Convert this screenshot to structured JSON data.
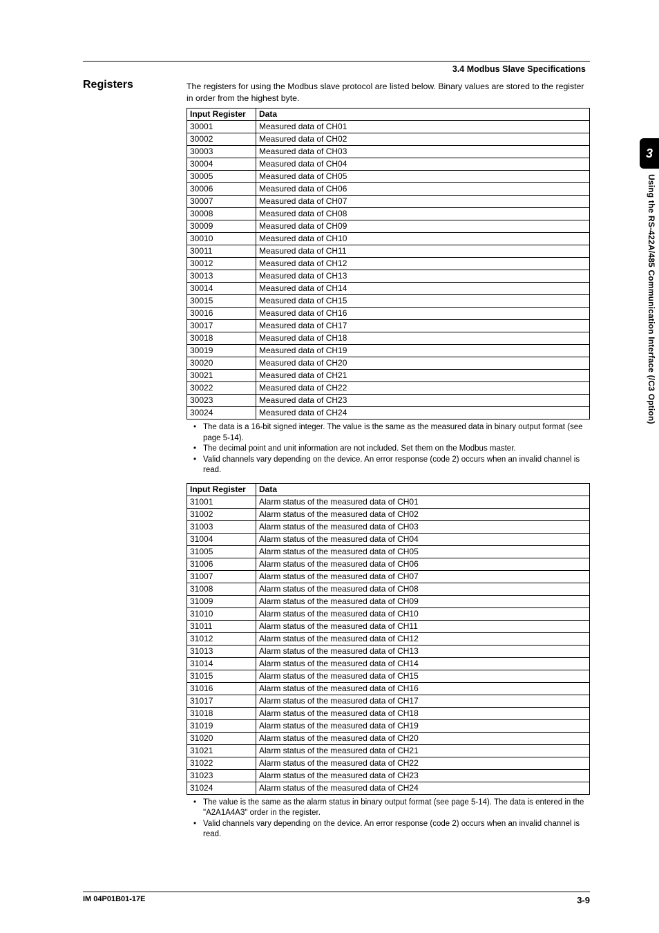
{
  "header": {
    "section_number_title": "3.4  Modbus Slave Specifications"
  },
  "heading": "Registers",
  "intro": "The registers for using the Modbus slave protocol are listed below. Binary values are stored to the register in order from the highest byte.",
  "table1": {
    "cols": [
      "Input Register",
      "Data"
    ],
    "rows": [
      [
        "30001",
        "Measured data of CH01"
      ],
      [
        "30002",
        "Measured data of CH02"
      ],
      [
        "30003",
        "Measured data of CH03"
      ],
      [
        "30004",
        "Measured data of CH04"
      ],
      [
        "30005",
        "Measured data of CH05"
      ],
      [
        "30006",
        "Measured data of CH06"
      ],
      [
        "30007",
        "Measured data of CH07"
      ],
      [
        "30008",
        "Measured data of CH08"
      ],
      [
        "30009",
        "Measured data of CH09"
      ],
      [
        "30010",
        "Measured data of CH10"
      ],
      [
        "30011",
        "Measured data of CH11"
      ],
      [
        "30012",
        "Measured data of CH12"
      ],
      [
        "30013",
        "Measured data of CH13"
      ],
      [
        "30014",
        "Measured data of CH14"
      ],
      [
        "30015",
        "Measured data of CH15"
      ],
      [
        "30016",
        "Measured data of CH16"
      ],
      [
        "30017",
        "Measured data of CH17"
      ],
      [
        "30018",
        "Measured data of CH18"
      ],
      [
        "30019",
        "Measured data of CH19"
      ],
      [
        "30020",
        "Measured data of CH20"
      ],
      [
        "30021",
        "Measured data of CH21"
      ],
      [
        "30022",
        "Measured data of CH22"
      ],
      [
        "30023",
        "Measured data of CH23"
      ],
      [
        "30024",
        "Measured data of CH24"
      ]
    ]
  },
  "notes1": [
    "The data is a 16-bit signed integer. The value is the same as the measured data in binary output format (see page 5-14).",
    "The decimal point and unit information are not included. Set them on the Modbus master.",
    "Valid channels vary depending on the device. An error response (code 2) occurs when an invalid channel is read."
  ],
  "table2": {
    "cols": [
      "Input Register",
      "Data"
    ],
    "rows": [
      [
        "31001",
        "Alarm status of the measured data of CH01"
      ],
      [
        "31002",
        "Alarm status of the measured data of CH02"
      ],
      [
        "31003",
        "Alarm status of the measured data of CH03"
      ],
      [
        "31004",
        "Alarm status of the measured data of CH04"
      ],
      [
        "31005",
        "Alarm status of the measured data of CH05"
      ],
      [
        "31006",
        "Alarm status of the measured data of CH06"
      ],
      [
        "31007",
        "Alarm status of the measured data of CH07"
      ],
      [
        "31008",
        "Alarm status of the measured data of CH08"
      ],
      [
        "31009",
        "Alarm status of the measured data of CH09"
      ],
      [
        "31010",
        "Alarm status of the measured data of CH10"
      ],
      [
        "31011",
        "Alarm status of the measured data of CH11"
      ],
      [
        "31012",
        "Alarm status of the measured data of CH12"
      ],
      [
        "31013",
        "Alarm status of the measured data of CH13"
      ],
      [
        "31014",
        "Alarm status of the measured data of CH14"
      ],
      [
        "31015",
        "Alarm status of the measured data of CH15"
      ],
      [
        "31016",
        "Alarm status of the measured data of CH16"
      ],
      [
        "31017",
        "Alarm status of the measured data of CH17"
      ],
      [
        "31018",
        "Alarm status of the measured data of CH18"
      ],
      [
        "31019",
        "Alarm status of the measured data of CH19"
      ],
      [
        "31020",
        "Alarm status of the measured data of CH20"
      ],
      [
        "31021",
        "Alarm status of the measured data of CH21"
      ],
      [
        "31022",
        "Alarm status of the measured data of CH22"
      ],
      [
        "31023",
        "Alarm status of the measured data of CH23"
      ],
      [
        "31024",
        "Alarm status of the measured data of CH24"
      ]
    ]
  },
  "notes2": [
    "The value is the same as the alarm status in binary output format (see page 5-14). The data is entered in the \"A2A1A4A3\" order in the register.",
    "Valid channels vary depending on the device. An error response (code 2) occurs when an invalid channel is read."
  ],
  "sidebar": {
    "tab": "3",
    "text": "Using the RS-422A/485 Communication Interface (/C3 Option)"
  },
  "footer": {
    "left": "IM 04P01B01-17E",
    "right": "3-9"
  }
}
